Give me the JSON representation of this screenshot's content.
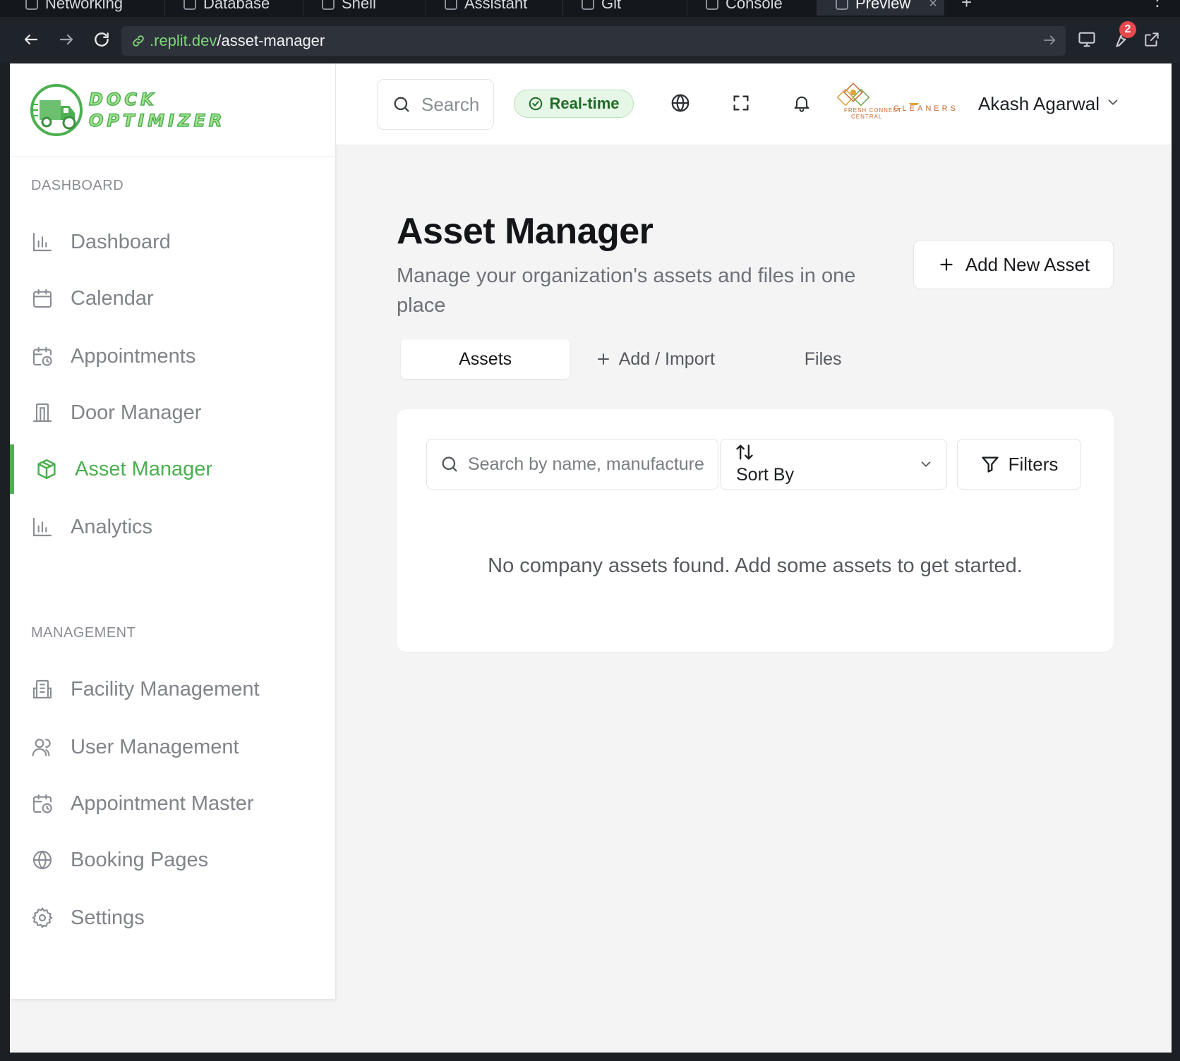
{
  "browser": {
    "tabs": [
      "Networking",
      "Database",
      "Shell",
      "Assistant",
      "Git",
      "Console",
      "Preview"
    ],
    "active_tab": "Preview",
    "url_host": ".replit.dev",
    "url_path": "/asset-manager",
    "notification_count": "2"
  },
  "brand": {
    "line1": "DOCK",
    "line2": "OPTIMIZER",
    "accent": "#4caf50"
  },
  "sidebar": {
    "dashboard_section": "DASHBOARD",
    "dashboard_items": [
      {
        "label": "Dashboard",
        "icon": "bar-chart-icon"
      },
      {
        "label": "Calendar",
        "icon": "calendar-icon"
      },
      {
        "label": "Appointments",
        "icon": "calendar-clock-icon"
      },
      {
        "label": "Door Manager",
        "icon": "door-icon"
      },
      {
        "label": "Asset Manager",
        "icon": "boxes-icon",
        "active": true
      },
      {
        "label": "Analytics",
        "icon": "bar-chart-icon"
      }
    ],
    "management_section": "MANAGEMENT",
    "management_items": [
      {
        "label": "Facility Management",
        "icon": "building-icon"
      },
      {
        "label": "User Management",
        "icon": "users-icon"
      },
      {
        "label": "Appointment Master",
        "icon": "calendar-clock-icon"
      },
      {
        "label": "Booking Pages",
        "icon": "globe-icon"
      },
      {
        "label": "Settings",
        "icon": "gear-icon"
      }
    ]
  },
  "header": {
    "search_placeholder": "Search",
    "realtime_label": "Real-time",
    "client_logo_text": "FRESH CONNECT",
    "client_logo_sub": "CENTRAL",
    "client_logo_name": "GLEANERS",
    "user_name": "Akash Agarwal"
  },
  "page": {
    "title": "Asset Manager",
    "subtitle": "Manage your organization's assets and files in one place",
    "add_button": "Add New Asset",
    "tabs": [
      "Assets",
      "Add / Import",
      "Files"
    ],
    "active_tab": "Assets"
  },
  "filters": {
    "search_placeholder": "Search by name, manufacturer...",
    "sort_label": "Sort By",
    "filters_label": "Filters"
  },
  "empty_state": "No company assets found. Add some assets to get started."
}
